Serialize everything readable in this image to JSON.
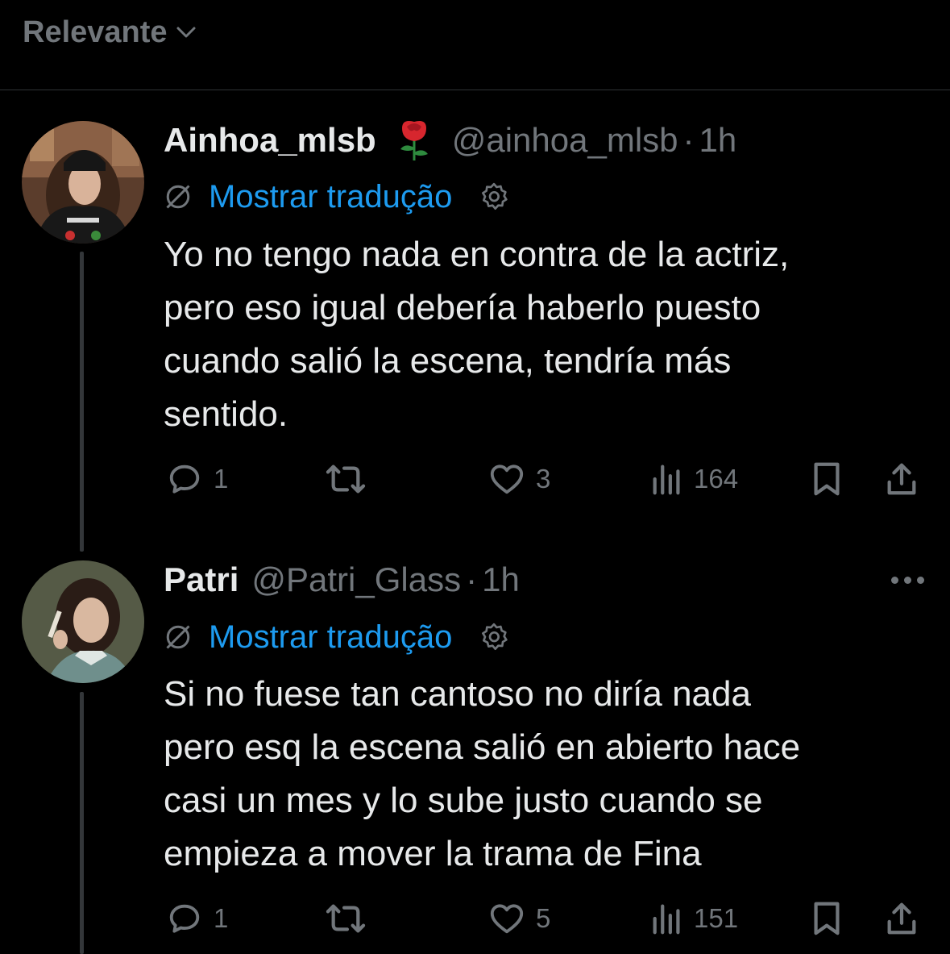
{
  "header": {
    "sort_label": "Relevante"
  },
  "colors": {
    "background": "#000000",
    "text": "#e7e9ea",
    "muted": "#71767b",
    "link": "#1d9bf0",
    "divider": "#2f3336"
  },
  "icons": {
    "sort": "chevron-down-icon",
    "emoji": "rose-emoji",
    "no_translate": "globe-off-icon",
    "settings": "gear-icon",
    "reply": "reply-icon",
    "retweet": "retweet-icon",
    "like": "heart-icon",
    "views": "views-chart-icon",
    "bookmark": "bookmark-icon",
    "share": "share-icon",
    "more": "more-dots-icon"
  },
  "tweets": [
    {
      "name": "Ainhoa_mlsb",
      "emoji": "🌹",
      "handle": "@ainhoa_mlsb",
      "separator": "·",
      "time": "1h",
      "translate_label": "Mostrar tradução",
      "text": "Yo no tengo nada en contra de la actriz,\npero eso igual debería haberlo puesto\ncuando salió la escena, tendría más\nsentido.",
      "replies": "1",
      "retweets": "",
      "likes": "3",
      "views": "164"
    },
    {
      "name": "Patri",
      "handle": "@Patri_Glass",
      "separator": "·",
      "time": "1h",
      "translate_label": "Mostrar tradução",
      "text": "Si no fuese tan cantoso no diría nada\npero esq la escena salió en abierto hace\ncasi un mes y lo sube justo cuando se\nempieza a mover la trama de Fina",
      "replies": "1",
      "retweets": "",
      "likes": "5",
      "views": "151"
    }
  ]
}
